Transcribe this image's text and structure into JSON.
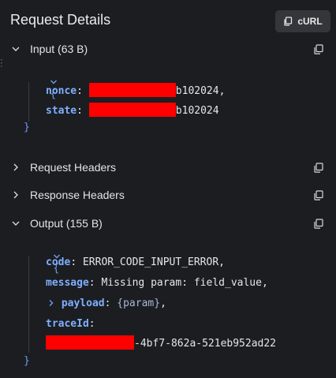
{
  "header": {
    "title": "Request Details",
    "curl_label": "cURL"
  },
  "sections": {
    "input": {
      "label": "Input (63 B)"
    },
    "request_headers": {
      "label": "Request Headers"
    },
    "response_headers": {
      "label": "Response Headers"
    },
    "output": {
      "label": "Output (155 B)"
    }
  },
  "input_json": {
    "open": "{",
    "close": "}",
    "nonce_key": "nonce",
    "nonce_value_suffix": "b102024",
    "nonce_value_tail": ",",
    "state_key": "state",
    "state_value_suffix": "b102024"
  },
  "output_json": {
    "open": "{",
    "close": "}",
    "code_key": "code",
    "code_value": "ERROR_CODE_INPUT_ERROR,",
    "message_key": "message",
    "message_value": "Missing param: field_value,",
    "payload_key": "payload",
    "payload_value": "{param}",
    "payload_tail": ",",
    "traceid_key": "traceId",
    "traceid_value_suffix": "-4bf7-862a-521eb952ad22"
  },
  "colors": {
    "background": "#1c1d21",
    "key": "#7eb0ff",
    "brace": "#6e9cf0",
    "redaction": "#ff0000"
  }
}
